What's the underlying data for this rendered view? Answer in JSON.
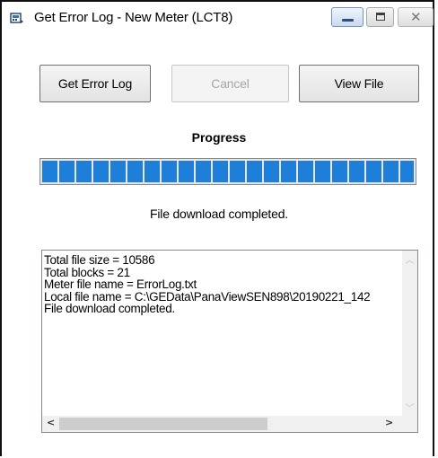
{
  "window": {
    "title": "Get Error Log - New Meter (LCT8)",
    "app_icon": "meter-app-icon",
    "minimize_icon": "minimize-icon",
    "maximize_icon": "maximize-icon",
    "close_icon": "close-icon",
    "close_glyph": "✕"
  },
  "buttons": {
    "get_error_log": "Get Error Log",
    "cancel": "Cancel",
    "cancel_enabled": false,
    "view_file": "View File"
  },
  "progress": {
    "label": "Progress",
    "fraction": 1.0,
    "color": "#1e7fd9",
    "status": "File download completed."
  },
  "log": {
    "lines": [
      "Total file size = 10586",
      "Total blocks = 21",
      "Meter file name = ErrorLog.txt",
      "Local file name = C:\\GEData\\PanaViewSEN898\\20190221_142",
      "File download completed."
    ],
    "scroll_up_glyph": "︿",
    "scroll_down_glyph": "﹀",
    "scroll_left_glyph": "<",
    "scroll_right_glyph": ">"
  }
}
